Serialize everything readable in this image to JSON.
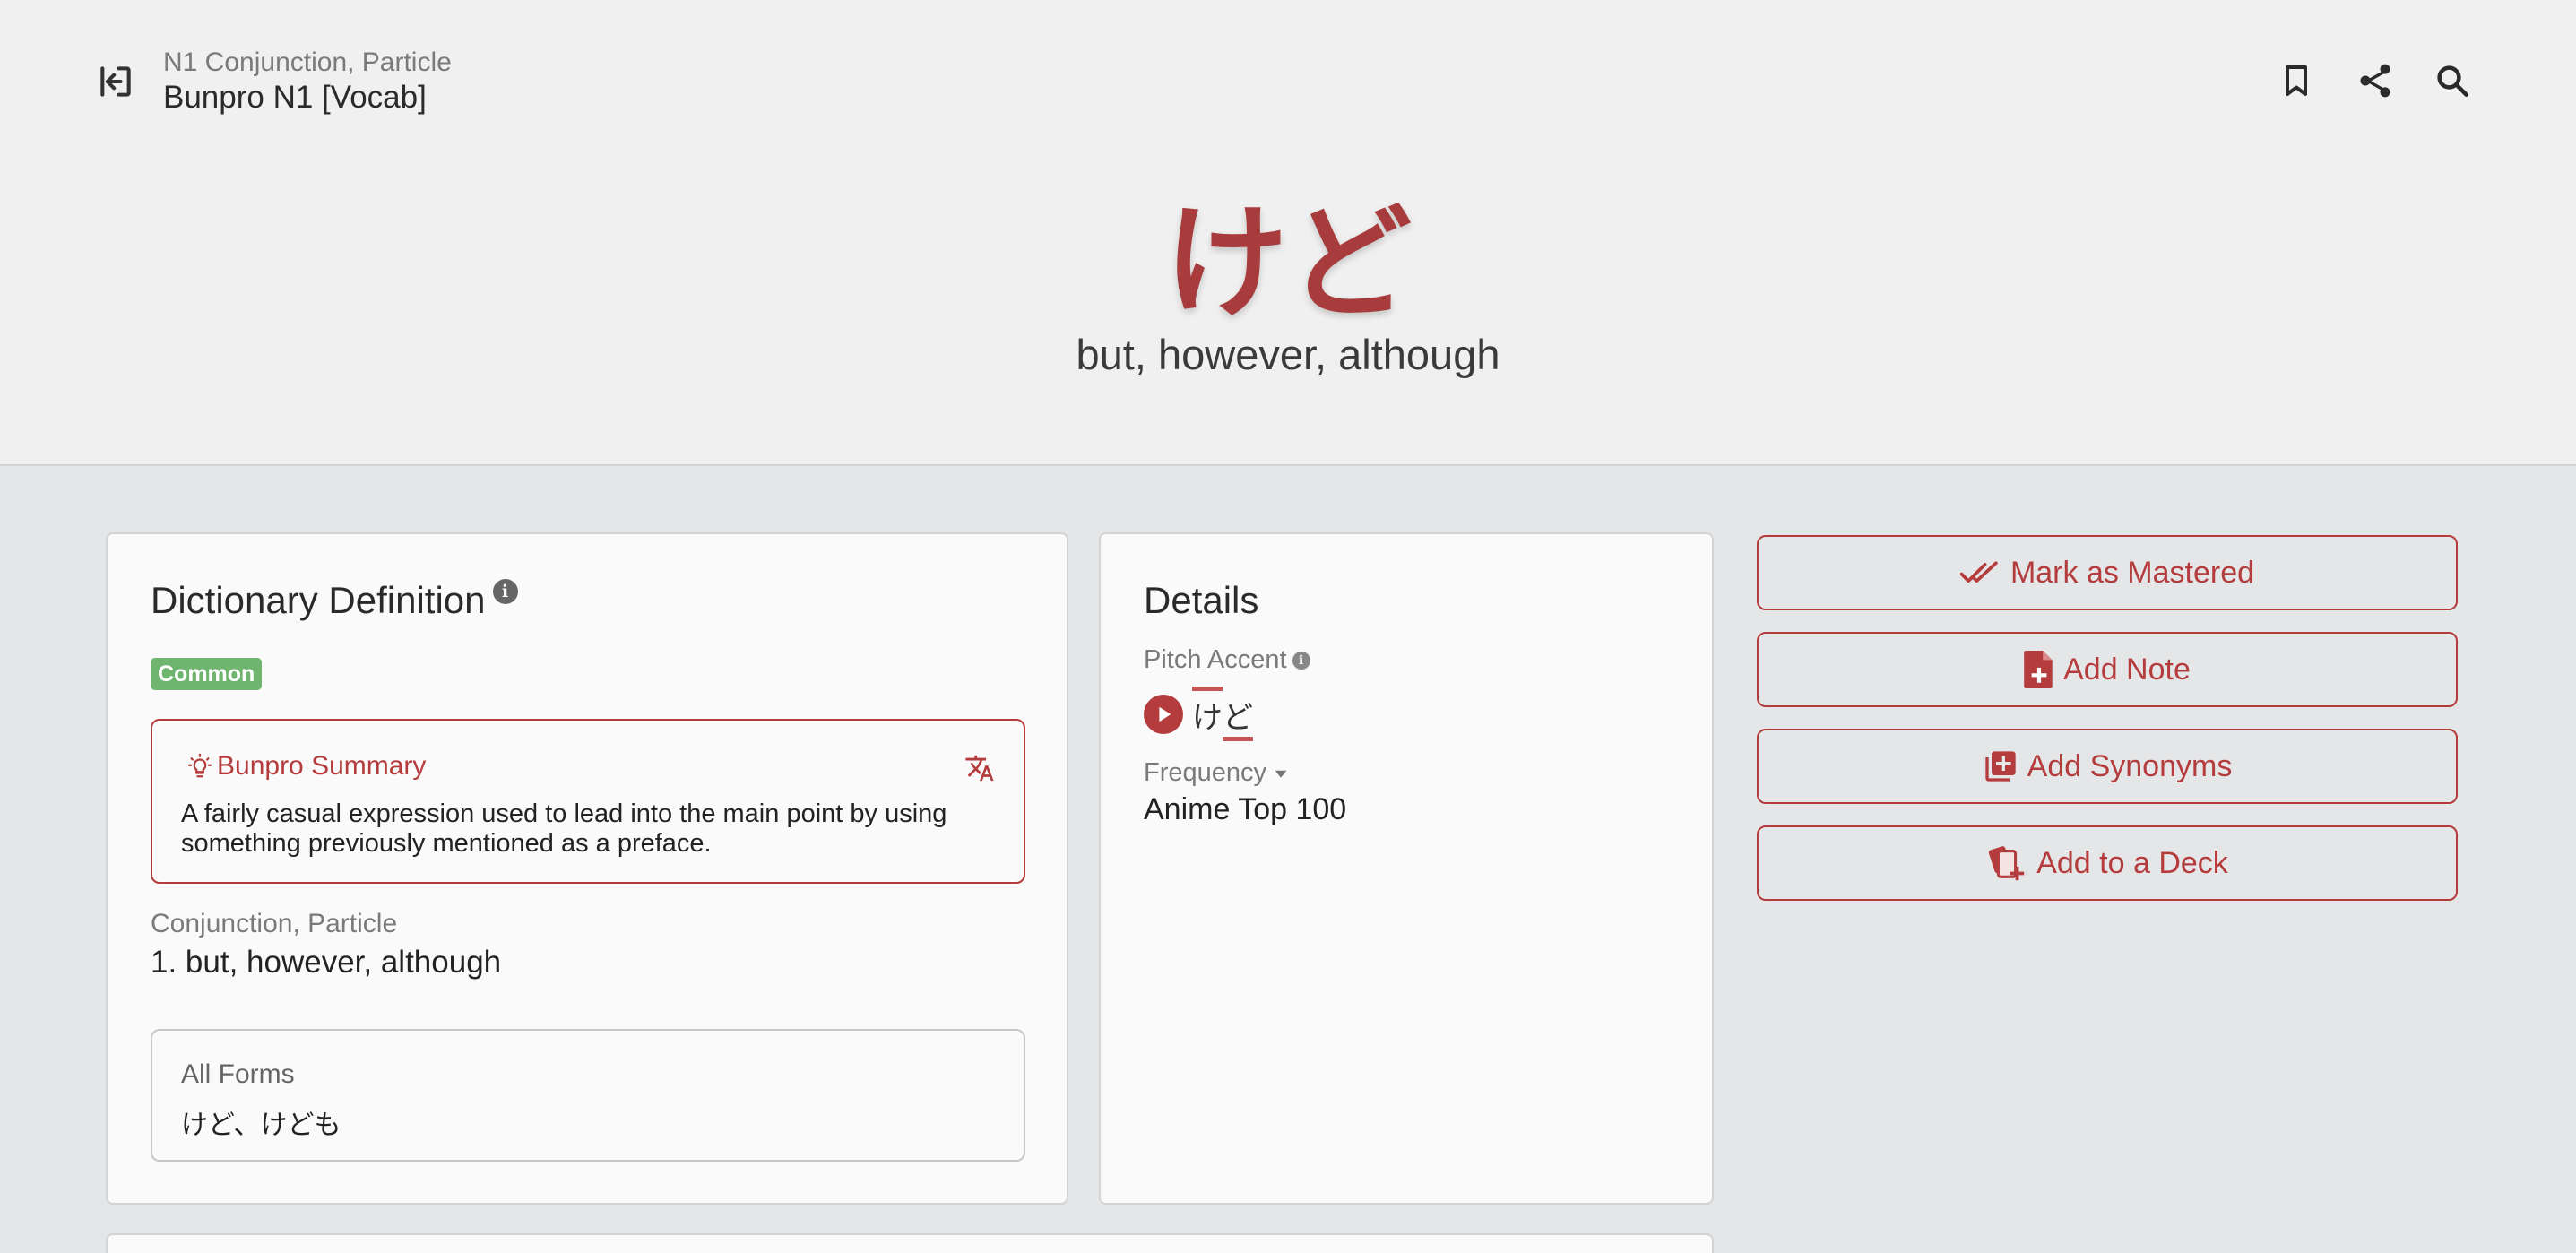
{
  "header": {
    "category": "N1 Conjunction, Particle",
    "deck": "Bunpro N1 [Vocab]",
    "icons": [
      "exit-icon",
      "bookmark-icon",
      "share-icon",
      "search-icon"
    ]
  },
  "hero": {
    "word": "けど",
    "meaning": "but, however, although"
  },
  "dictionary": {
    "title": "Dictionary Definition",
    "info": "i",
    "badge": "Common",
    "summary_title": "Bunpro Summary",
    "summary_text": "A fairly casual expression used to lead into the main point by using something previously mentioned as a preface.",
    "pos": "Conjunction, Particle",
    "definition": "1.  but, however, although",
    "forms_label": "All Forms",
    "forms_value": "けど、けども"
  },
  "details": {
    "title": "Details",
    "pitch_label": "Pitch Accent",
    "pitch_info": "i",
    "pitch_char1": "け",
    "pitch_char2": "ど",
    "frequency_label": "Frequency",
    "frequency_value": "Anime Top 100"
  },
  "actions": {
    "mastered": "Mark as Mastered",
    "note": "Add Note",
    "synonyms": "Add Synonyms",
    "deck": "Add to a Deck"
  },
  "colors": {
    "accent": "#b43c3c",
    "word": "#a83c3c",
    "badge": "#6fb56f",
    "background": "#e5e6e8",
    "hero_background": "#f0f0f0"
  }
}
